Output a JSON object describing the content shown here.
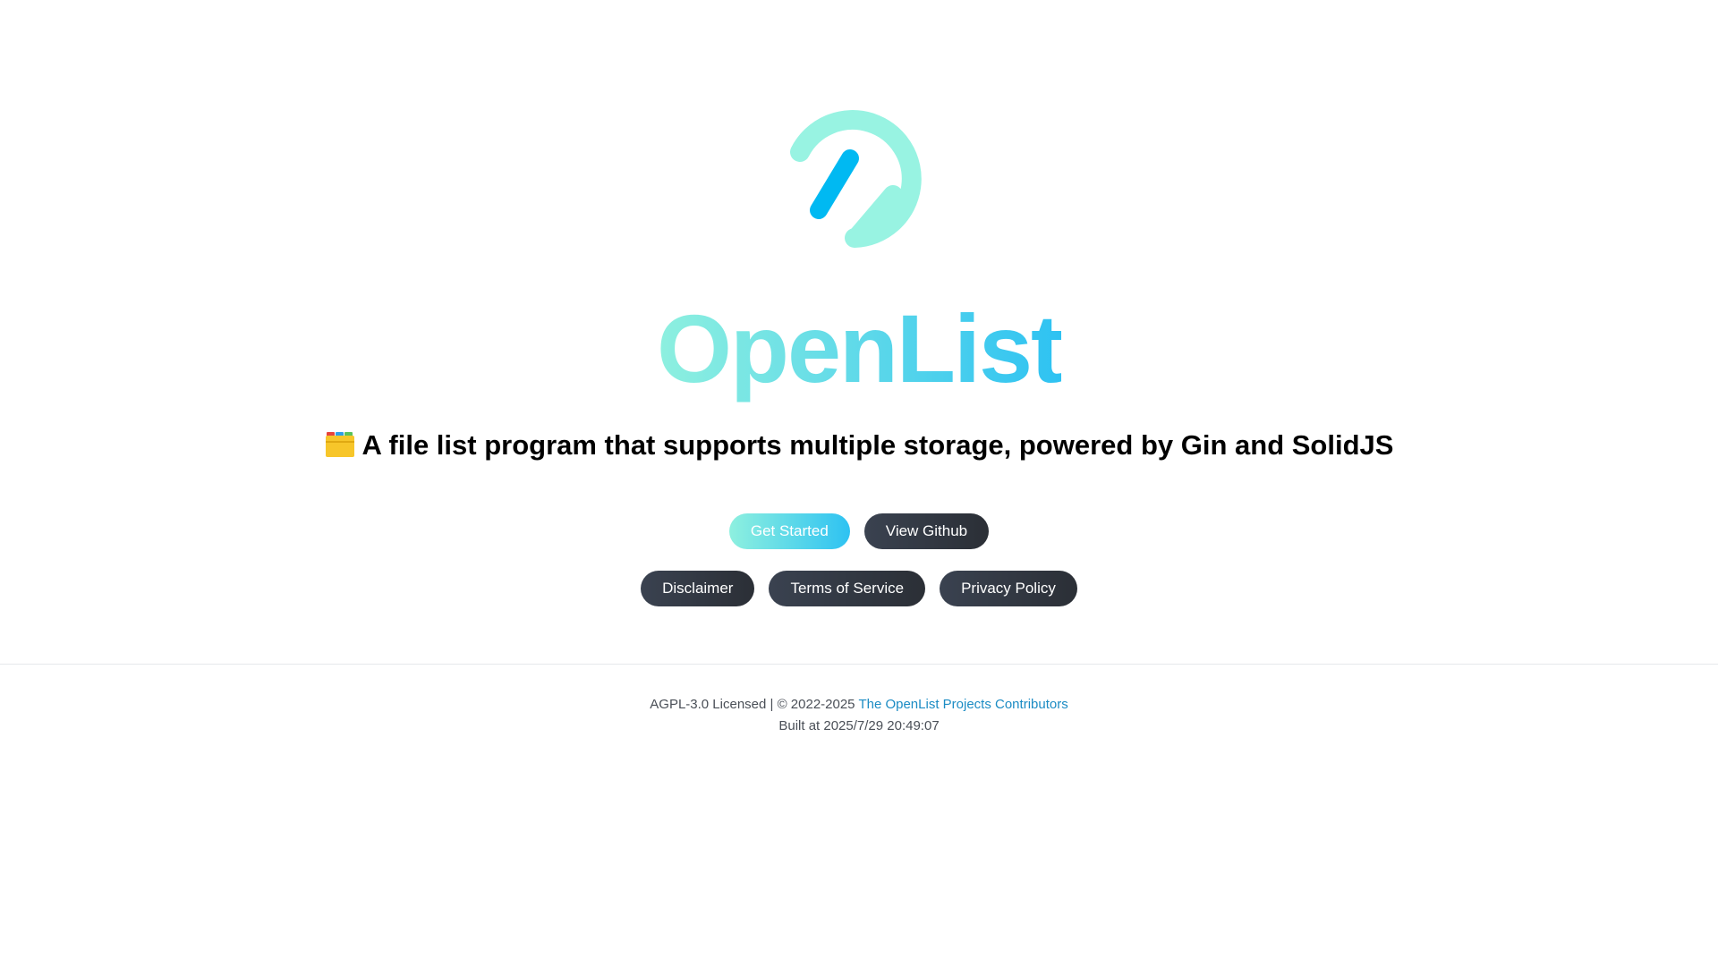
{
  "brand": {
    "title": "OpenList",
    "logo_icon": "openlist-logo-icon",
    "colors": {
      "mint": "#8ef0df",
      "blue": "#2ec2f2",
      "dark_button": "#2b2f36"
    }
  },
  "tagline": {
    "icon": "card-index-dividers-icon",
    "text": "A file list program that supports multiple storage, powered by Gin and SolidJS"
  },
  "actions": {
    "primary": [
      {
        "label": "Get Started"
      },
      {
        "label": "View Github"
      }
    ],
    "secondary": [
      {
        "label": "Disclaimer"
      },
      {
        "label": "Terms of Service"
      },
      {
        "label": "Privacy Policy"
      }
    ]
  },
  "footer": {
    "license_text": "AGPL-3.0 Licensed | © 2022-2025",
    "contributors_link": "The OpenList Projects Contributors",
    "built_at": "Built at 2025/7/29 20:49:07"
  }
}
